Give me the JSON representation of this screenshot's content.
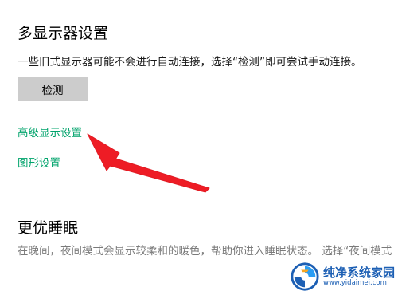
{
  "multi_display": {
    "title": "多显示器设置",
    "description": "一些旧式显示器可能不会进行自动连接，选择“检测”即可尝试手动连接。",
    "detect_button": "检测"
  },
  "links": {
    "advanced_display": "高级显示设置",
    "graphics": "图形设置"
  },
  "night_light": {
    "title": "更优睡眠",
    "description": "在晚间，夜间模式会显示较柔和的暖色，帮助你进入睡眠状态。 选择“夜间模式"
  },
  "watermark": {
    "name": "纯净系统家园",
    "url": "www.yidaimei.com"
  },
  "colors": {
    "link": "#00a36b",
    "arrow": "#ee1c25",
    "button_bg": "#cccccc",
    "watermark": "#1c5fb4"
  }
}
